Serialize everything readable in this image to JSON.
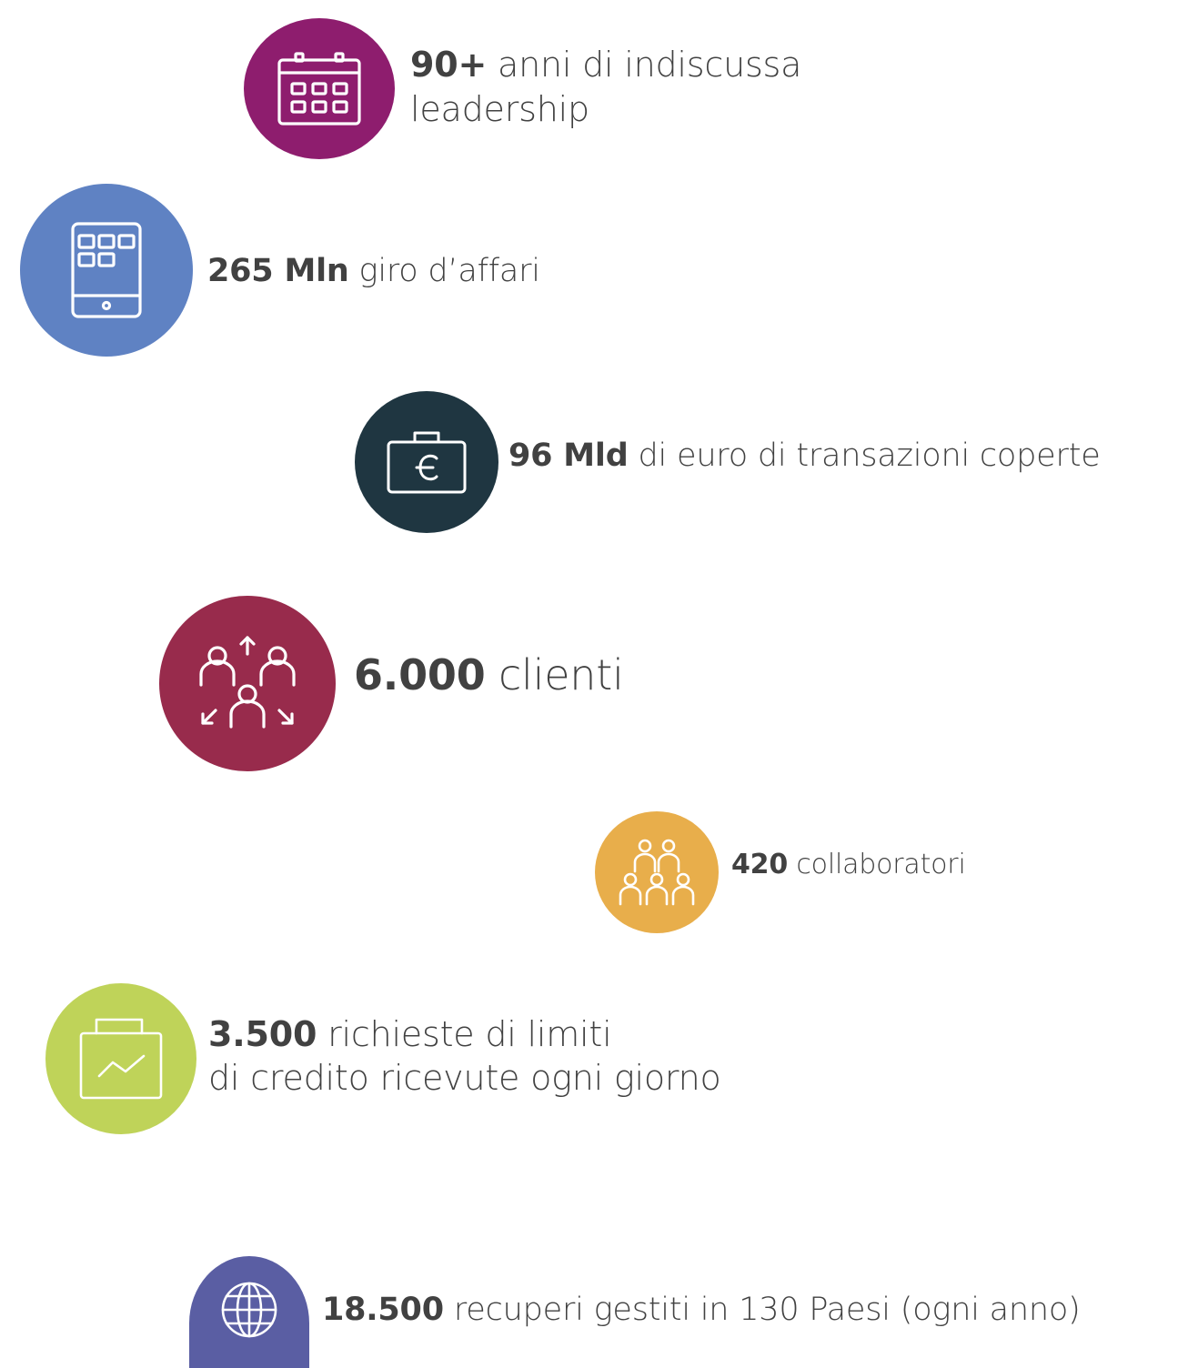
{
  "colors": {
    "text": "#414141",
    "icon_stroke": "#ffffff"
  },
  "stats": [
    {
      "id": "years",
      "icon": "calendar-icon",
      "color": "#8e1d6e",
      "value": "90+",
      "label": "anni di indiscussa",
      "label_line2": "leadership"
    },
    {
      "id": "turnover",
      "icon": "tablet-icon",
      "color": "#5f82c3",
      "value": "265 Mln",
      "label": "giro d’affari"
    },
    {
      "id": "transactions",
      "icon": "euro-briefcase-icon",
      "color": "#1f3641",
      "value": "96 Mld",
      "label": "di euro di transazioni coperte"
    },
    {
      "id": "clients",
      "icon": "people-network-icon",
      "color": "#982b4c",
      "value": "6.000",
      "label": "clienti"
    },
    {
      "id": "collaborators",
      "icon": "team-icon",
      "color": "#e8ae4b",
      "value": "420",
      "label": "collaboratori"
    },
    {
      "id": "requests",
      "icon": "chart-briefcase-icon",
      "color": "#bfd359",
      "value": "3.500",
      "label": "richieste di limiti",
      "label_line2": "di credito ricevute ogni giorno"
    },
    {
      "id": "recoveries",
      "icon": "globe-icon",
      "color": "#5a5ea3",
      "value": "18.500",
      "label": "recuperi gestiti in 130 Paesi (ogni anno)"
    }
  ]
}
